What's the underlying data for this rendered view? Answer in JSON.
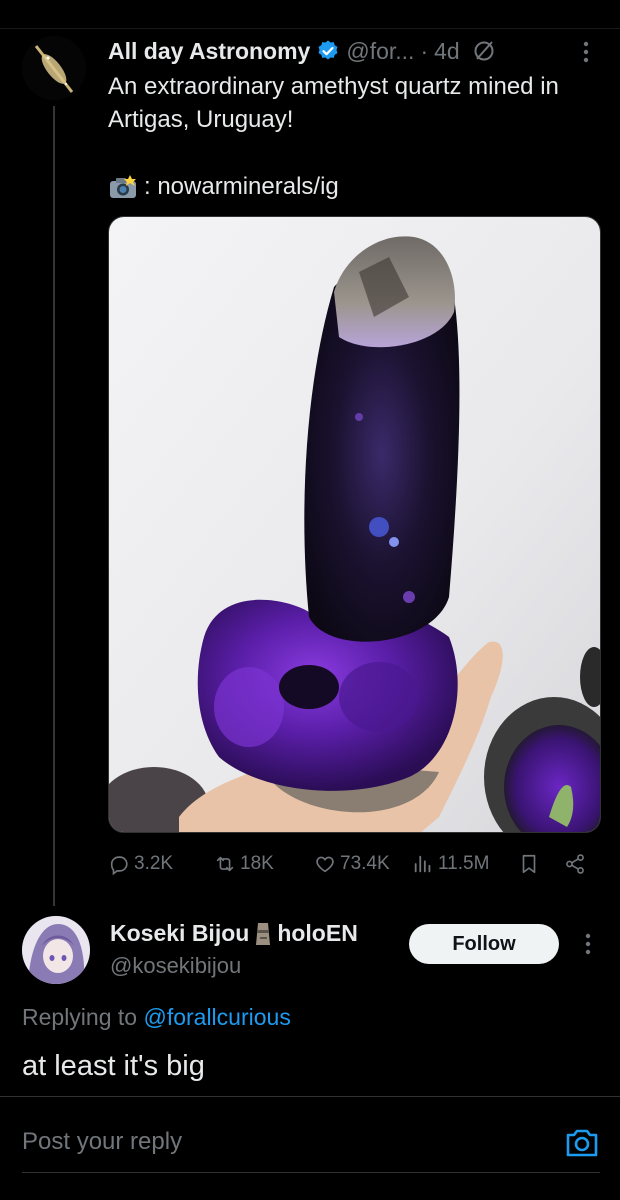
{
  "tweet": {
    "author_name": "All day Astronomy",
    "handle": "@for...",
    "separator": "·",
    "time": "4d",
    "text_lines": [
      "An extraordinary amethyst quartz mined in Artigas, Uruguay!"
    ],
    "credit_text": ": nowarminerals/ig",
    "stats": {
      "replies": "3.2K",
      "reposts": "18K",
      "likes": "73.4K",
      "views": "11.5M"
    }
  },
  "reply": {
    "author_name_part1": "Koseki Bijou",
    "author_name_part2": "holoEN",
    "handle": "@kosekibijou",
    "follow_label": "Follow",
    "replying_prefix": "Replying to",
    "replying_to": "@forallcurious",
    "text": "at least it's big"
  },
  "composer": {
    "placeholder": "Post your reply"
  },
  "icons": {
    "verified": "verified-badge-icon",
    "grok": "grok-icon",
    "more": "more-icon",
    "camera_emoji": "camera-flash-emoji-icon",
    "reply": "reply-icon",
    "repost": "repost-icon",
    "like": "heart-icon",
    "views": "views-icon",
    "bookmark": "bookmark-icon",
    "share": "share-icon",
    "moai": "moai-emoji-icon",
    "camera": "camera-icon"
  },
  "colors": {
    "background": "#000000",
    "text": "#e7e9ea",
    "muted": "#71767b",
    "link": "#1d9bf0",
    "follow_bg": "#eff3f4"
  }
}
